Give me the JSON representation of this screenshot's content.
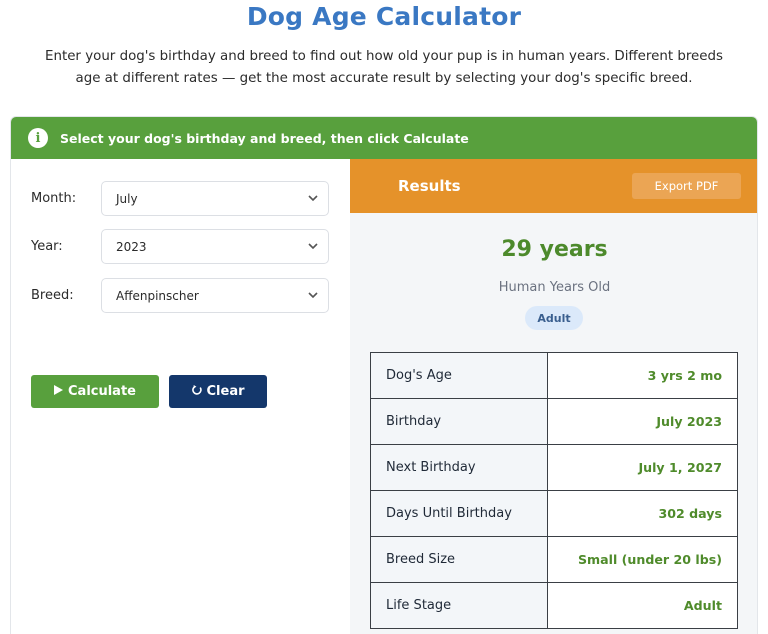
{
  "page": {
    "title": "Dog Age Calculator",
    "intro": "Enter your dog's birthday and breed to find out how old your pup is in human years. Different breeds age at different rates — get the most accurate result by selecting your dog's specific breed."
  },
  "banner": {
    "icon": "info-icon",
    "text": "Select your dog's birthday and breed, then click Calculate"
  },
  "form": {
    "month": {
      "label": "Month:",
      "value": "July"
    },
    "year": {
      "label": "Year:",
      "value": "2023"
    },
    "breed": {
      "label": "Breed:",
      "value": "Affenpinscher"
    },
    "calculate_label": "Calculate",
    "clear_label": "Clear"
  },
  "results": {
    "title": "Results",
    "export_label": "Export PDF",
    "years": "29 years",
    "human_label": "Human Years Old",
    "stage_badge": "Adult",
    "rows": [
      {
        "label": "Dog's Age",
        "value": "3 yrs 2 mo"
      },
      {
        "label": "Birthday",
        "value": "July 2023"
      },
      {
        "label": "Next Birthday",
        "value": "July 1, 2027"
      },
      {
        "label": "Days Until Birthday",
        "value": "302 days"
      },
      {
        "label": "Breed Size",
        "value": "Small (under 20 lbs)"
      },
      {
        "label": "Life Stage",
        "value": "Adult"
      }
    ]
  },
  "colors": {
    "title_blue": "#3a78c3",
    "green": "#58a03d",
    "navy": "#14376b",
    "orange": "#e5922a",
    "value_green": "#4f8b2b"
  }
}
